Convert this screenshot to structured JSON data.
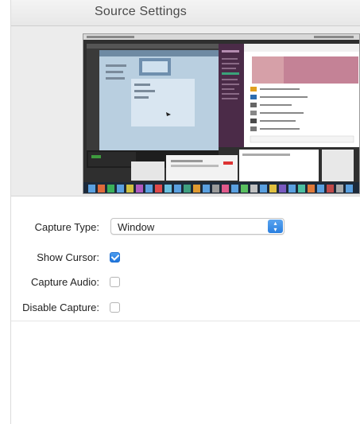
{
  "header": {
    "title": "Source Settings"
  },
  "form": {
    "capture_type": {
      "label": "Capture Type:",
      "value": "Window"
    },
    "show_cursor": {
      "label": "Show Cursor:",
      "checked": true
    },
    "capture_audio": {
      "label": "Capture Audio:",
      "checked": false
    },
    "disable_capture": {
      "label": "Disable Capture:",
      "checked": false
    }
  },
  "colors": {
    "accent": "#2a7fe0",
    "header_text": "#4a4a4a",
    "preview_bg": "#ececec"
  }
}
